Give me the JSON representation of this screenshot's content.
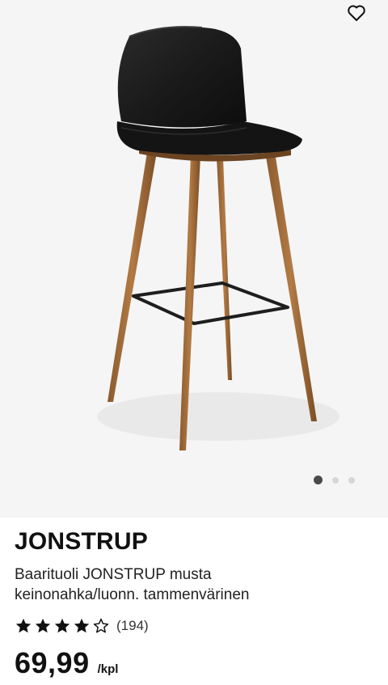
{
  "product": {
    "brand": "JONSTRUP",
    "description_line1": "Baarituoli JONSTRUP musta",
    "description_line2": "keinonahka/luonn. tammenvärinen",
    "rating": {
      "value": 4,
      "max": 5,
      "count": "(194)"
    },
    "price": "69,99",
    "unit": "/kpl"
  },
  "gallery": {
    "dots_total": 3,
    "active_index": 0
  },
  "icons": {
    "wishlist": "heart-outline-icon"
  },
  "colors": {
    "image_bg": "#f5f5f5",
    "text": "#111111",
    "dot_active": "#4a4a4a",
    "dot_inactive": "#d6d6d6"
  }
}
